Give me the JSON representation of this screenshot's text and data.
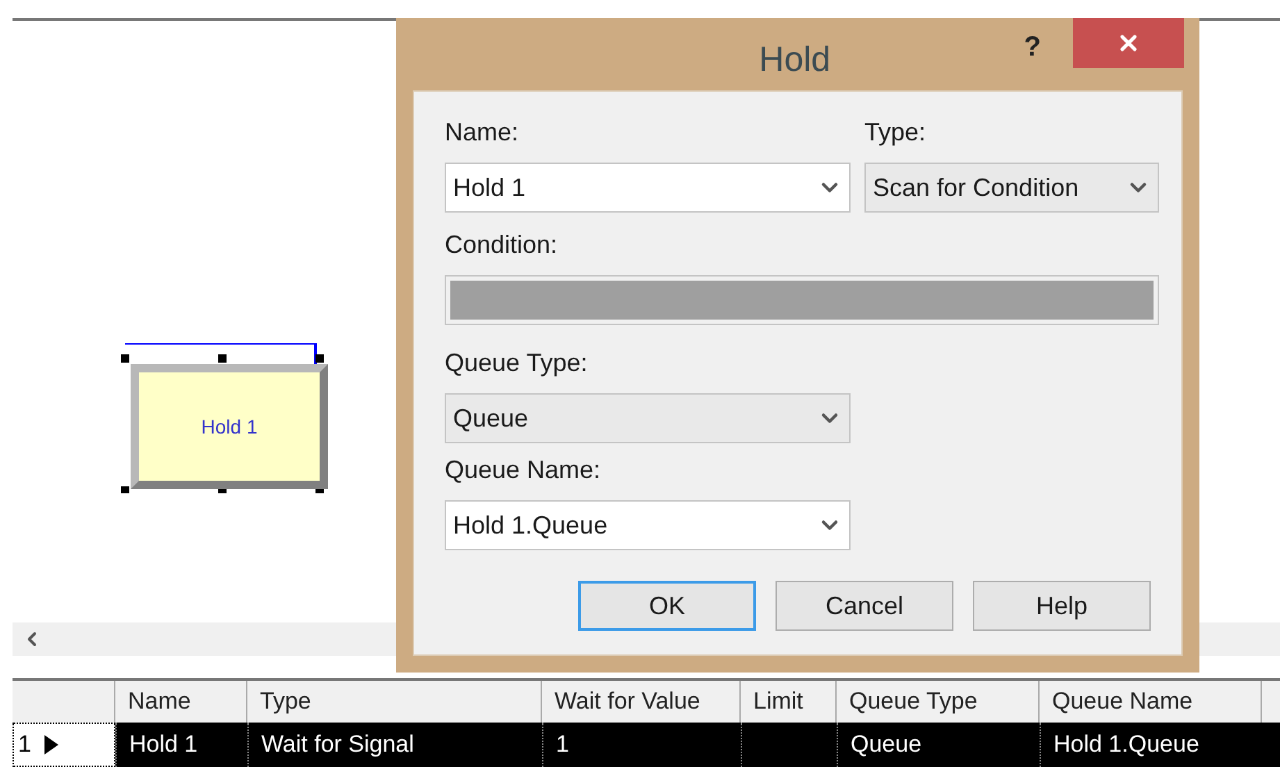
{
  "canvas": {
    "modules": [
      {
        "label": "Hold 1",
        "selected": true
      }
    ]
  },
  "dialog": {
    "title": "Hold",
    "help": "?",
    "name": {
      "label": "Name:",
      "value": "Hold 1"
    },
    "type": {
      "label": "Type:",
      "value": "Scan for Condition"
    },
    "condition": {
      "label": "Condition:",
      "disabled": true
    },
    "queue_type": {
      "label": "Queue Type:",
      "value": "Queue"
    },
    "queue_name": {
      "label": "Queue Name:",
      "value": "Hold 1.Queue"
    },
    "buttons": [
      {
        "label": "OK",
        "default": true
      },
      {
        "label": "Cancel",
        "default": false
      },
      {
        "label": "Help",
        "default": false
      }
    ]
  },
  "table": {
    "columns": [
      "Name",
      "Type",
      "Wait for Value",
      "Limit",
      "Queue Type",
      "Queue Name"
    ],
    "rows": [
      {
        "number": "1",
        "selected": true,
        "cells": [
          "Hold 1",
          "Wait for Signal",
          "1",
          "",
          "Queue",
          "Hold 1.Queue"
        ]
      }
    ]
  }
}
